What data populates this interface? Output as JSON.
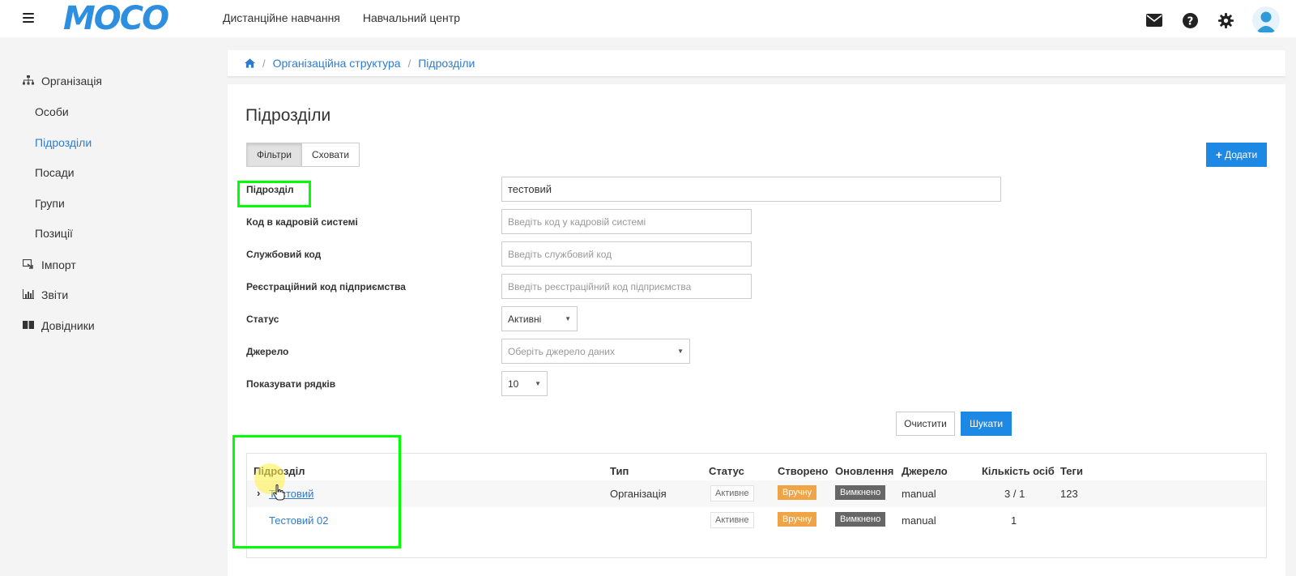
{
  "topbar": {
    "logo": "MOCO",
    "nav": [
      "Дистанційне навчання",
      "Навчальний центр"
    ]
  },
  "sidebar": {
    "organization": "Організація",
    "sub_items": [
      "Особи",
      "Підрозділи",
      "Посади",
      "Групи",
      "Позиції"
    ],
    "active_item": "Підрозділи",
    "import": "Імпорт",
    "reports": "Звіти",
    "directories": "Довідники"
  },
  "breadcrumb": {
    "items": [
      "Організаційна структура",
      "Підрозділи"
    ]
  },
  "page": {
    "title": "Підрозділи",
    "filters_button": "Фільтри",
    "hide_button": "Сховати",
    "add_button": "Додати"
  },
  "filters": {
    "unit_label": "Підрозділ",
    "unit_value": "тестовий",
    "hr_code_label": "Код в кадровій системі",
    "hr_code_placeholder": "Введіть код у кадровій системі",
    "service_code_label": "Службовий код",
    "service_code_placeholder": "Введіть службовий код",
    "reg_code_label": "Реєстраційний код підприємства",
    "reg_code_placeholder": "Введіть реєстраційний код підприємства",
    "status_label": "Статус",
    "status_value": "Активні",
    "source_label": "Джерело",
    "source_placeholder": "Оберіть джерело даних",
    "rows_label": "Показувати рядків",
    "rows_value": "10",
    "clear_button": "Очистити",
    "search_button": "Шукати"
  },
  "table": {
    "headers": [
      "Підрозділ",
      "Тип",
      "Статус",
      "Створено",
      "Оновлення",
      "Джерело",
      "Кількість осіб",
      "Теги"
    ],
    "rows": [
      {
        "name": "Тестовий",
        "type": "Організація",
        "status": "Активне",
        "created": "Вручну",
        "updated": "Вимкнено",
        "source": "manual",
        "count": "3 / 1",
        "tags": "123"
      },
      {
        "name": "Тестовий 02",
        "type": "",
        "status": "Активне",
        "created": "Вручну",
        "updated": "Вимкнено",
        "source": "manual",
        "count": "1",
        "tags": ""
      }
    ]
  },
  "colors": {
    "accent": "#1e88e5",
    "link": "#2e7bd0",
    "badge_orange": "#f0a445",
    "badge_gray": "#666666",
    "highlight": "#00ff00"
  },
  "icons": {
    "menu": "hamburger-icon",
    "mail": "envelope-icon",
    "help": "question-circle-icon",
    "settings": "gear-icon",
    "user": "user-avatar-icon",
    "home": "home-icon",
    "org": "sitemap-icon",
    "import": "import-icon",
    "reports": "bar-chart-icon",
    "directories": "book-icon"
  }
}
